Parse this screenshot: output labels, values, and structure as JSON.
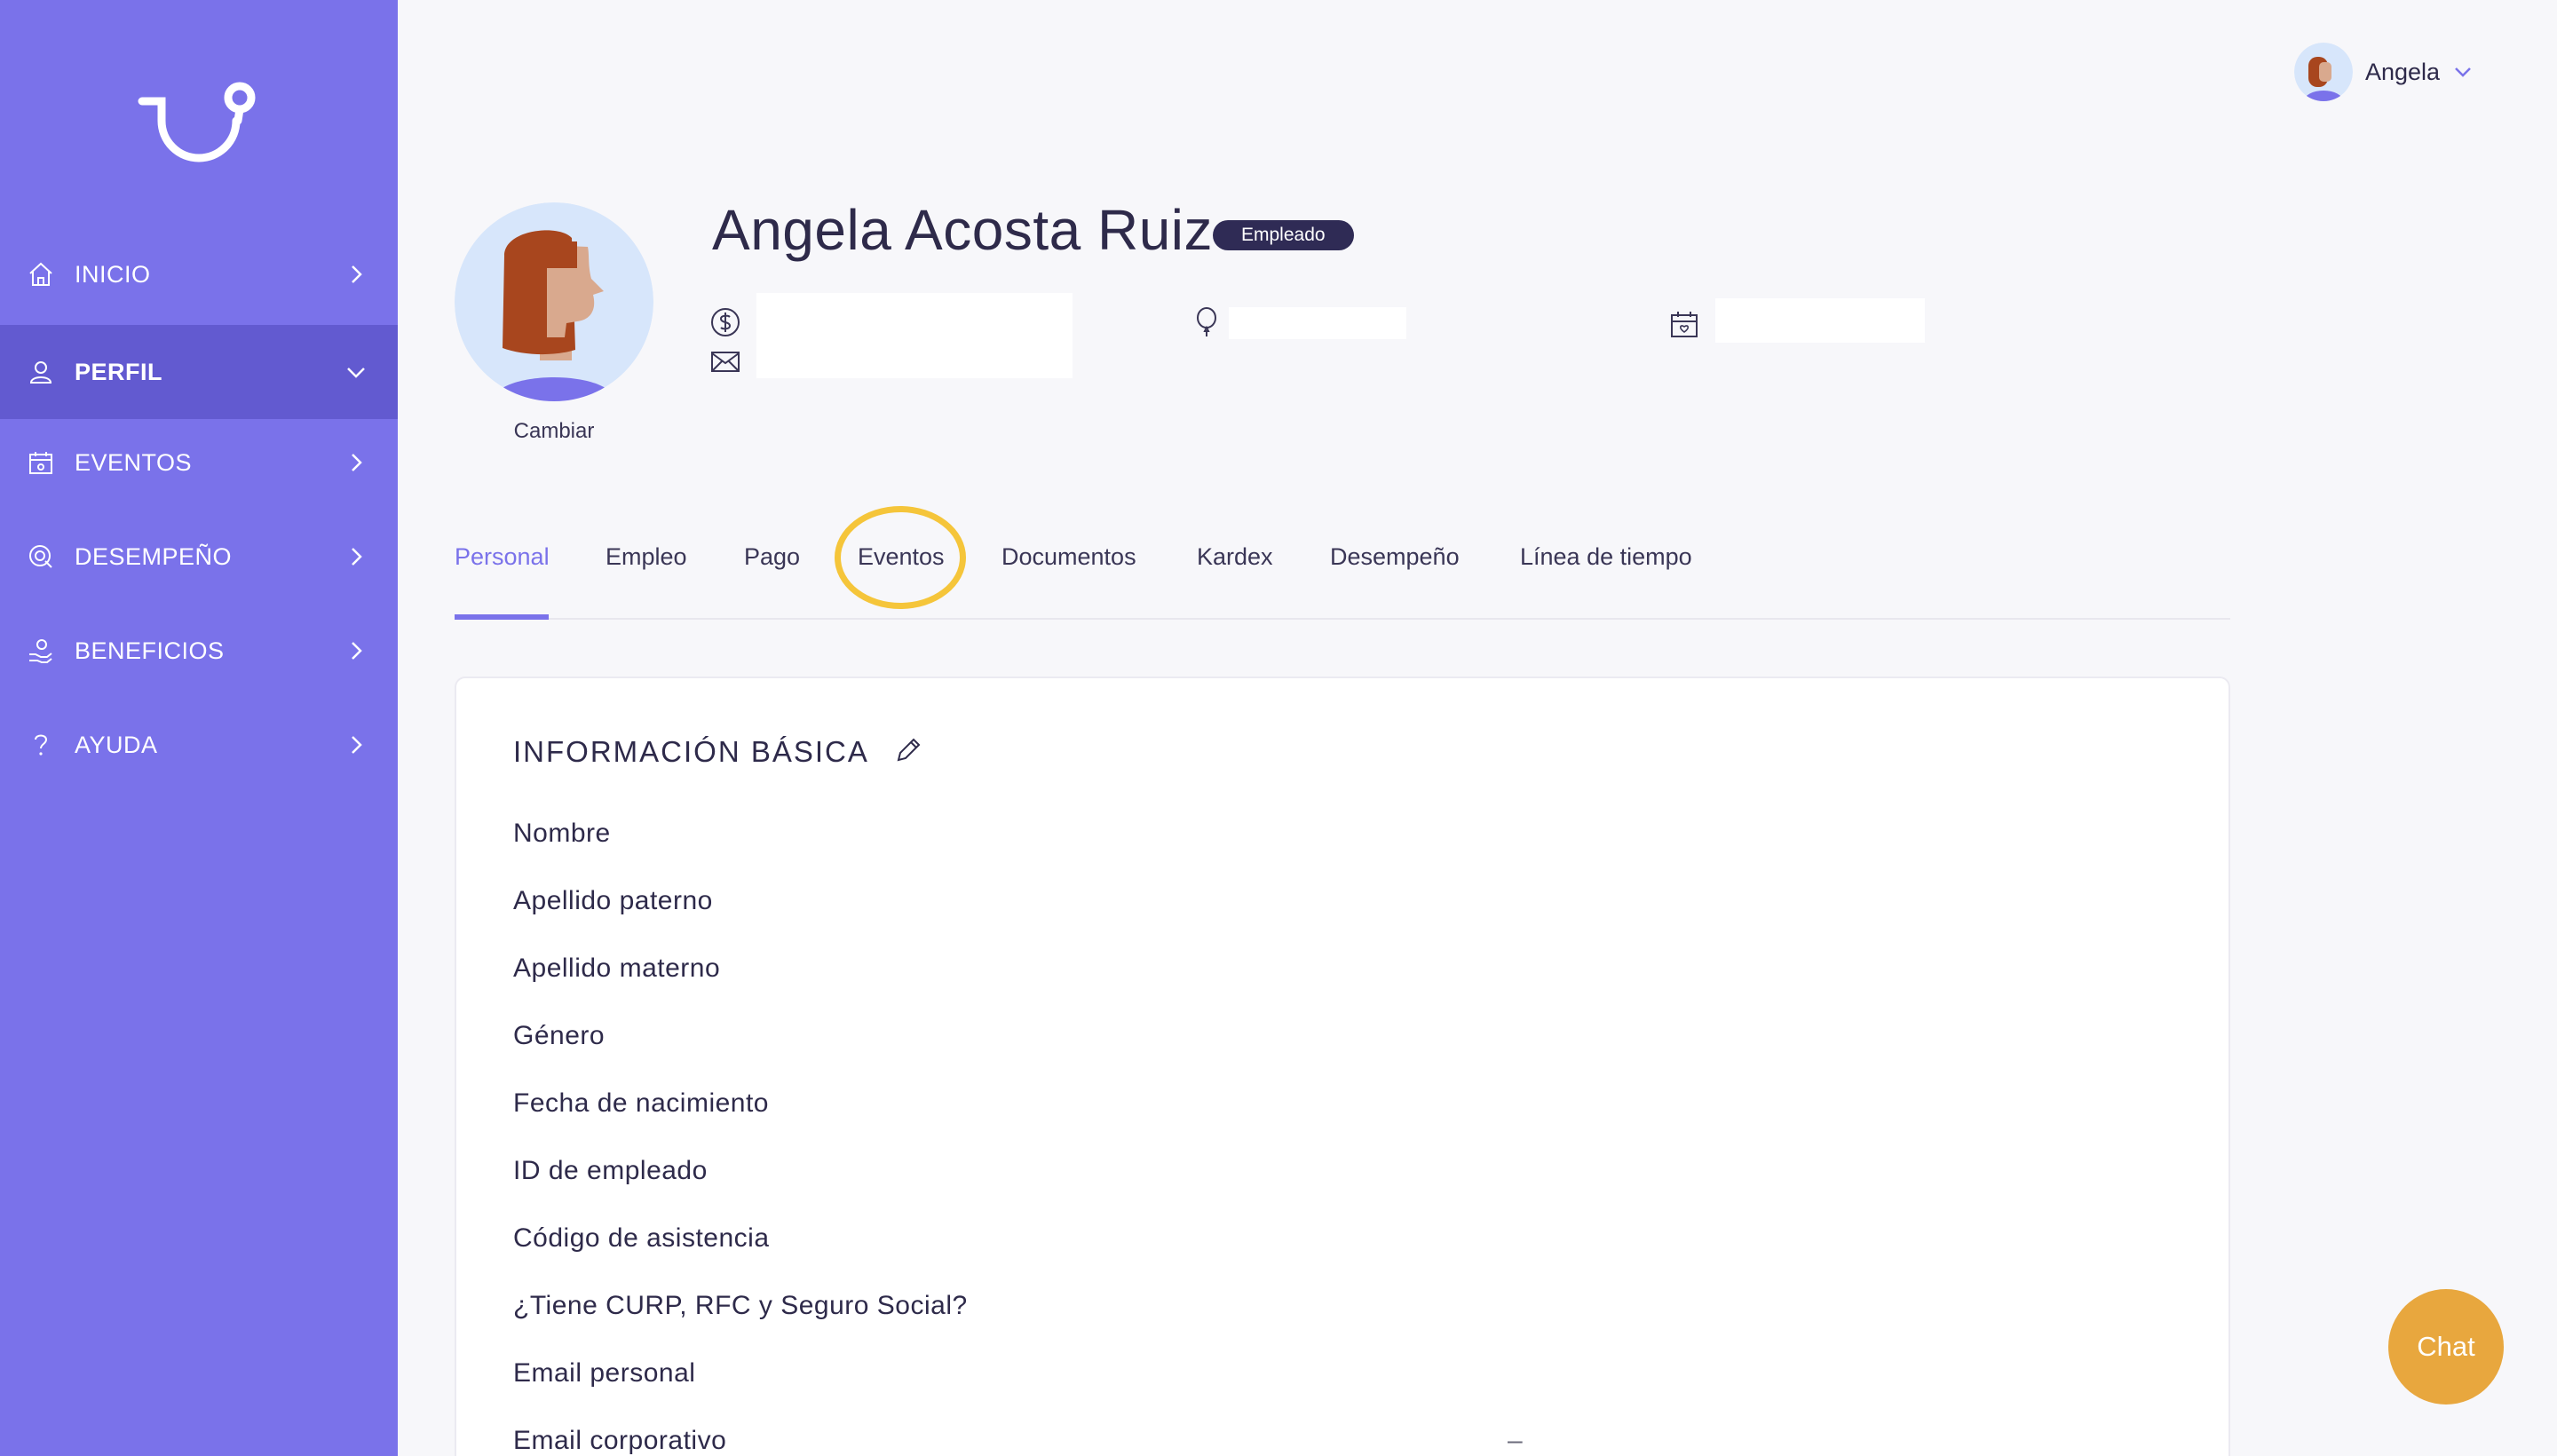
{
  "sidebar": {
    "logo": "app-logo",
    "items": [
      {
        "label": "INICIO",
        "icon": "home-icon"
      },
      {
        "label": "PERFIL",
        "icon": "user-icon",
        "active": true
      },
      {
        "label": "EVENTOS",
        "icon": "calendar-icon"
      },
      {
        "label": "DESEMPEÑO",
        "icon": "target-icon"
      },
      {
        "label": "BENEFICIOS",
        "icon": "hand-heart-icon"
      },
      {
        "label": "AYUDA",
        "icon": "question-icon"
      }
    ],
    "background": "#7a72ea",
    "active_background": "#625ad0"
  },
  "header": {
    "user_name": "Angela"
  },
  "profile": {
    "name": "Angela Acosta Ruiz",
    "badge": "Empleado",
    "change_photo": "Cambiar"
  },
  "tabs": [
    {
      "label": "Personal",
      "active": true
    },
    {
      "label": "Empleo"
    },
    {
      "label": "Pago"
    },
    {
      "label": "Eventos",
      "highlighted": true
    },
    {
      "label": "Documentos"
    },
    {
      "label": "Kardex"
    },
    {
      "label": "Desempeño"
    },
    {
      "label": "Línea de tiempo"
    }
  ],
  "card": {
    "title": "INFORMACIÓN BÁSICA",
    "fields": [
      {
        "label": "Nombre"
      },
      {
        "label": "Apellido paterno"
      },
      {
        "label": "Apellido materno"
      },
      {
        "label": "Género"
      },
      {
        "label": "Fecha de nacimiento"
      },
      {
        "label": "ID de empleado"
      },
      {
        "label": "Código de asistencia"
      },
      {
        "label": "¿Tiene CURP, RFC y Seguro Social?"
      },
      {
        "label": "Email personal"
      },
      {
        "label": "Email corporativo",
        "value": "–"
      }
    ]
  },
  "chat": {
    "label": "Chat"
  },
  "colors": {
    "accent": "#7a72ea",
    "highlight": "#f5c53a",
    "chat": "#e8a73e",
    "badge": "#2f2b55"
  }
}
